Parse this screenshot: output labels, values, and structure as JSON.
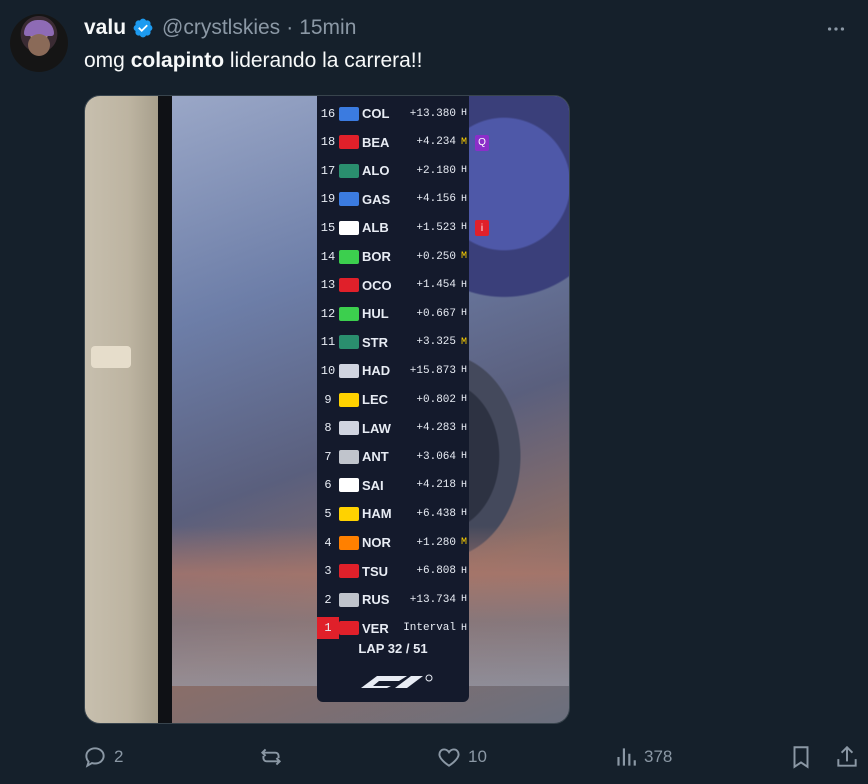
{
  "post": {
    "display_name": "valu",
    "handle": "@crystlskies",
    "separator": "·",
    "time": "15min",
    "text_before": "omg ",
    "text_bold": "colapinto",
    "text_after": " liderando la carrera!!"
  },
  "image": {
    "leaderboard": [
      {
        "pos": "16",
        "team_color": "#3b7be0",
        "driver": "COL",
        "gap": "+13.380",
        "tyre": "H"
      },
      {
        "pos": "18",
        "team_color": "#e0202a",
        "driver": "BEA",
        "gap": "+4.234",
        "tyre": "M"
      },
      {
        "pos": "17",
        "team_color": "#2a8e6e",
        "driver": "ALO",
        "gap": "+2.180",
        "tyre": "H"
      },
      {
        "pos": "19",
        "team_color": "#3b7be0",
        "driver": "GAS",
        "gap": "+4.156",
        "tyre": "H"
      },
      {
        "pos": "15",
        "team_color": "#ffffff",
        "driver": "ALB",
        "gap": "+1.523",
        "tyre": "H"
      },
      {
        "pos": "14",
        "team_color": "#3ccf4e",
        "driver": "BOR",
        "gap": "+0.250",
        "tyre": "M"
      },
      {
        "pos": "13",
        "team_color": "#e0202a",
        "driver": "OCO",
        "gap": "+1.454",
        "tyre": "H"
      },
      {
        "pos": "12",
        "team_color": "#3ccf4e",
        "driver": "HUL",
        "gap": "+0.667",
        "tyre": "H"
      },
      {
        "pos": "11",
        "team_color": "#2a8e6e",
        "driver": "STR",
        "gap": "+3.325",
        "tyre": "M"
      },
      {
        "pos": "10",
        "team_color": "#d0d4e0",
        "driver": "HAD",
        "gap": "+15.873",
        "tyre": "H"
      },
      {
        "pos": "9",
        "team_color": "#ffd200",
        "driver": "LEC",
        "gap": "+0.802",
        "tyre": "H"
      },
      {
        "pos": "8",
        "team_color": "#d0d4e0",
        "driver": "LAW",
        "gap": "+4.283",
        "tyre": "H"
      },
      {
        "pos": "7",
        "team_color": "#c0c4cc",
        "driver": "ANT",
        "gap": "+3.064",
        "tyre": "H"
      },
      {
        "pos": "6",
        "team_color": "#ffffff",
        "driver": "SAI",
        "gap": "+4.218",
        "tyre": "H"
      },
      {
        "pos": "5",
        "team_color": "#ffd200",
        "driver": "HAM",
        "gap": "+6.438",
        "tyre": "H"
      },
      {
        "pos": "4",
        "team_color": "#ff8000",
        "driver": "NOR",
        "gap": "+1.280",
        "tyre": "M"
      },
      {
        "pos": "3",
        "team_color": "#e0202a",
        "driver": "TSU",
        "gap": "+6.808",
        "tyre": "H"
      },
      {
        "pos": "2",
        "team_color": "#c0c4cc",
        "driver": "RUS",
        "gap": "+13.734",
        "tyre": "H"
      },
      {
        "pos": "1",
        "team_color": "#e0202a",
        "driver": "VER",
        "gap": "Interval",
        "tyre": "H"
      }
    ],
    "lap_text": "LAP 32 / 51",
    "badge_q": "Q",
    "badge_i": "i",
    "badge_q_color": "#8b2fc9",
    "badge_i_color": "#e0202a"
  },
  "actions": {
    "replies": "2",
    "reposts": "",
    "likes": "10",
    "views": "378"
  },
  "colors": {
    "background": "#15202b",
    "text": "#f7f9f9",
    "muted": "#8b98a5",
    "verified": "#1d9bf0"
  },
  "icons": [
    "verified-badge-icon",
    "more-icon",
    "reply-icon",
    "repost-icon",
    "like-icon",
    "views-icon",
    "bookmark-icon",
    "share-icon"
  ]
}
